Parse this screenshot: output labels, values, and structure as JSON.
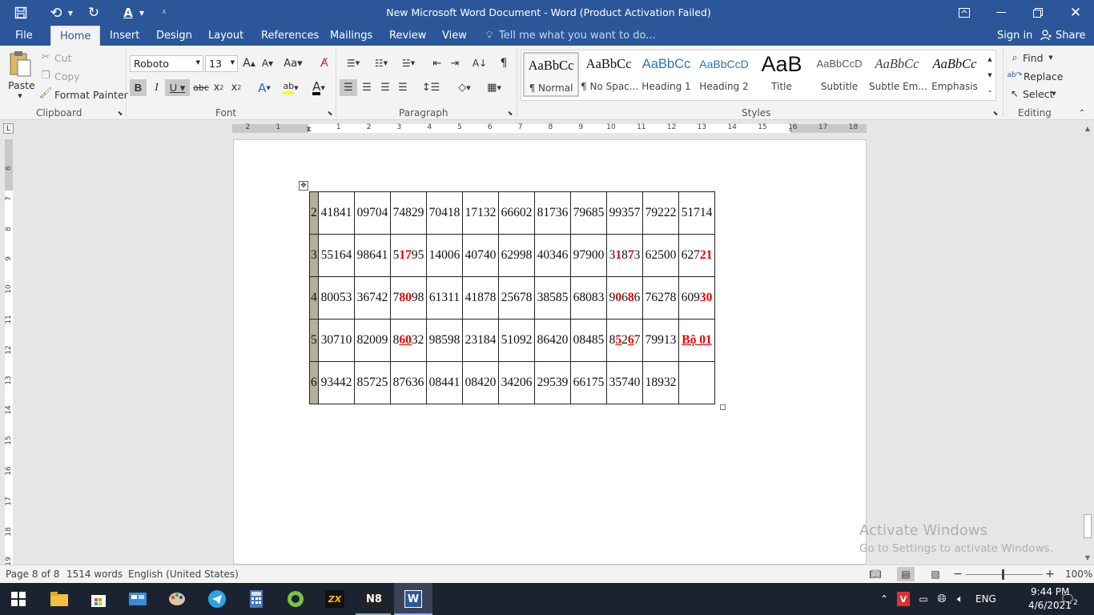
{
  "title_bar": {
    "title": "New Microsoft Word Document - Word (Product Activation Failed)"
  },
  "menu": {
    "file": "File",
    "tabs": [
      "Home",
      "Insert",
      "Design",
      "Layout",
      "References",
      "Mailings",
      "Review",
      "View"
    ],
    "tell_me": "Tell me what you want to do...",
    "sign_in": "Sign in",
    "share": "Share"
  },
  "ribbon": {
    "clipboard": {
      "paste": "Paste",
      "cut": "Cut",
      "copy": "Copy",
      "format_painter": "Format Painter",
      "label": "Clipboard"
    },
    "font": {
      "name": "Roboto",
      "size": "13",
      "label": "Font"
    },
    "paragraph": {
      "label": "Paragraph"
    },
    "styles": {
      "label": "Styles",
      "items": [
        {
          "sample": "AaBbCc",
          "name": "¶ Normal"
        },
        {
          "sample": "AaBbCc",
          "name": "¶ No Spac..."
        },
        {
          "sample": "AaBbCc",
          "name": "Heading 1"
        },
        {
          "sample": "AaBbCcD",
          "name": "Heading 2"
        },
        {
          "sample": "AaB",
          "name": "Title"
        },
        {
          "sample": "AaBbCcD",
          "name": "Subtitle"
        },
        {
          "sample": "AaBbCc",
          "name": "Subtle Em..."
        },
        {
          "sample": "AaBbCc",
          "name": "Emphasis"
        }
      ]
    },
    "editing": {
      "find": "Find",
      "replace": "Replace",
      "select": "Select",
      "label": "Editing"
    }
  },
  "ruler_numbers": [
    "2",
    "1",
    "1",
    "2",
    "3",
    "4",
    "5",
    "6",
    "7",
    "8",
    "9",
    "10",
    "11",
    "12",
    "13",
    "14",
    "15",
    "16",
    "17",
    "18"
  ],
  "vruler_numbers": [
    "6",
    "7",
    "8",
    "9",
    "10",
    "11",
    "12",
    "13",
    "14",
    "15",
    "16",
    "17",
    "18",
    "19"
  ],
  "table": {
    "rows": [
      {
        "id": "2",
        "cells": [
          "41841",
          "09704",
          "74829",
          "70418",
          "17132",
          "66602",
          "81736",
          "79685",
          "99357",
          "79222",
          "51714"
        ]
      },
      {
        "id": "3",
        "cells": [
          "55164",
          "98641",
          "51795",
          "14006",
          "40740",
          "62998",
          "40346",
          "97900",
          "31873",
          "62500",
          "62721"
        ]
      },
      {
        "id": "4",
        "cells": [
          "80053",
          "36742",
          "78098",
          "61311",
          "41878",
          "25678",
          "38585",
          "68083",
          "90686",
          "76278",
          "60930"
        ]
      },
      {
        "id": "5",
        "cells": [
          "30710",
          "82009",
          "86032",
          "98598",
          "23184",
          "51092",
          "86420",
          "08485",
          "85267",
          "79913",
          "Bộ 01"
        ]
      },
      {
        "id": "6",
        "cells": [
          "93442",
          "85725",
          "87636",
          "08441",
          "08420",
          "34206",
          "29539",
          "66175",
          "35740",
          "18932",
          ""
        ]
      }
    ]
  },
  "watermark": {
    "line1": "Activate Windows",
    "line2": "Go to Settings to activate Windows."
  },
  "status": {
    "page": "Page 8 of 8",
    "words": "1514 words",
    "language": "English (United States)",
    "zoom": "100%"
  },
  "taskbar": {
    "lang": "ENG",
    "time": "9:44 PM",
    "date": "4/6/2021",
    "notifications": "2"
  },
  "colors": {
    "accent": "#2b579a",
    "highlight_red": "#e00000",
    "table_shade": "#b5b09e"
  }
}
